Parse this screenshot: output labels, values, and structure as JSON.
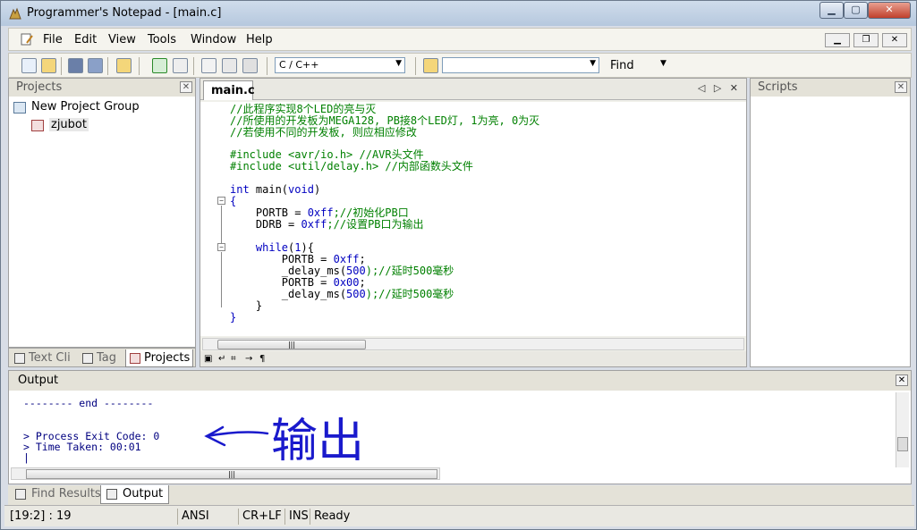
{
  "window": {
    "title": "Programmer's Notepad - [main.c]",
    "min_label": "▁",
    "max_label": "▢",
    "close_label": "✕"
  },
  "menu": {
    "items": [
      "File",
      "Edit",
      "View",
      "Tools",
      "Window",
      "Help"
    ],
    "mdi_min": "▁",
    "mdi_restore": "❐",
    "mdi_close": "✕"
  },
  "toolbar": {
    "language": "C / C++",
    "find_value": "",
    "find_label": "Find",
    "dropdown_arrow": "▼"
  },
  "projects_panel": {
    "title": "Projects",
    "close": "✕",
    "tree": {
      "group": "New Project Group",
      "project": "zjubot"
    },
    "tabs": [
      "Text Cli",
      "Tag",
      "Projects"
    ],
    "active_tab": "Projects"
  },
  "editor": {
    "tab_label": "main.c",
    "tab_nav": "◁ ▷ ✕",
    "lines": {
      "c1": "//此程序实现8个LED的亮与灭",
      "c2": "//所使用的开发板为MEGA128, PB接8个LED灯, 1为亮, 0为灭",
      "c3": "//若使用不同的开发板, 则应相应修改",
      "inc1_kw": "#include",
      "inc1_path": " <avr/io.h>",
      "inc1_cmt": " //AVR头文件",
      "inc2_kw": "#include",
      "inc2_path": " <util/delay.h>",
      "inc2_cmt": " //内部函数头文件",
      "main_kw": "int",
      "main_rest": " main(",
      "main_void": "void",
      "main_close": ")",
      "brace_open": "{",
      "portb1": "    PORTB = ",
      "portb1_val": "0xff",
      "portb1_cmt": ";//初始化PB口",
      "ddrb": "    DDRB = ",
      "ddrb_val": "0xff",
      "ddrb_cmt": ";//设置PB口为输出",
      "while_kw": "    while",
      "while_rest": "(",
      "while_num": "1",
      "while_end": "){",
      "l_portb_ff": "        PORTB = ",
      "l_portb_ff_val": "0xff",
      "l_portb_ff_end": ";",
      "l_delay1": "        _delay_ms(",
      "l_delay1_num": "500",
      "l_delay1_cmt": ");//延时500毫秒",
      "l_portb_00": "        PORTB = ",
      "l_portb_00_val": "0x00",
      "l_portb_00_end": ";",
      "l_delay2": "        _delay_ms(",
      "l_delay2_num": "500",
      "l_delay2_cmt": ");//延时500毫秒",
      "inner_close": "    }",
      "brace_close": "}"
    },
    "scroll_grip": "|||",
    "bottom_icons": [
      "▣",
      "↵",
      "⌗",
      "→",
      "¶"
    ]
  },
  "scripts_panel": {
    "title": "Scripts",
    "close": "✕"
  },
  "output_panel": {
    "title": "Output",
    "close": "✕",
    "text": "-------- end --------\n\n\n> Process Exit Code: 0\n> Time Taken: 00:01\n|",
    "scroll_grip": "|||",
    "annotation": "输出"
  },
  "bottom_tabs": [
    "Find Results",
    "Output"
  ],
  "active_bottom_tab": "Output",
  "status": {
    "position": "[19:2] : 19",
    "encoding": "ANSI",
    "line_ending": "CR+LF",
    "mode": "INS",
    "state": "Ready"
  },
  "colors": {
    "comment": "#008000",
    "keyword": "#0000c0",
    "output_text": "#000080",
    "annotation_ink": "#1a1acc"
  }
}
